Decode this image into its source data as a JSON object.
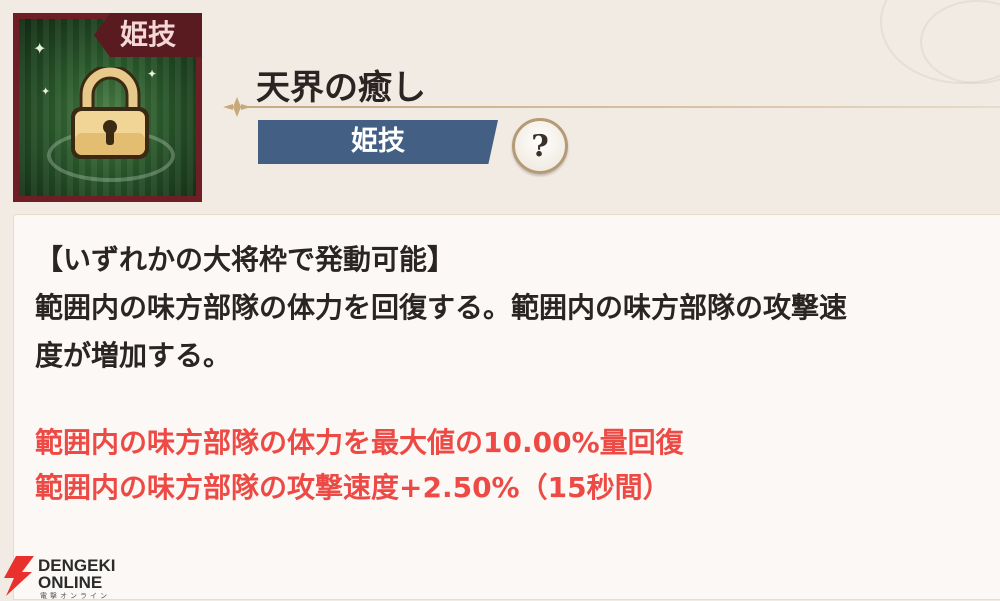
{
  "skill": {
    "icon_name": "lock-icon",
    "icon_tag": "姫技",
    "title": "天界の癒し",
    "type_badge": "姫技",
    "help_label": "?"
  },
  "description": {
    "lines": [
      "【いずれかの大将枠で発動可能】",
      "範囲内の味方部隊の体力を回復する。範囲内の味方部隊の攻撃速",
      "度が増加する。"
    ],
    "effects": [
      "範囲内の味方部隊の体力を最大値の10.00%量回復",
      "範囲内の味方部隊の攻撃速度+2.50%（15秒間）"
    ],
    "effect_color": "#ee4a45"
  },
  "watermark": {
    "line1": "DENGEKI",
    "line2": "ONLINE",
    "line3": "電撃オンライン"
  },
  "colors": {
    "badge": "#435f84",
    "icon_frame": "#6e1e25",
    "background": "#f2ebe3"
  }
}
